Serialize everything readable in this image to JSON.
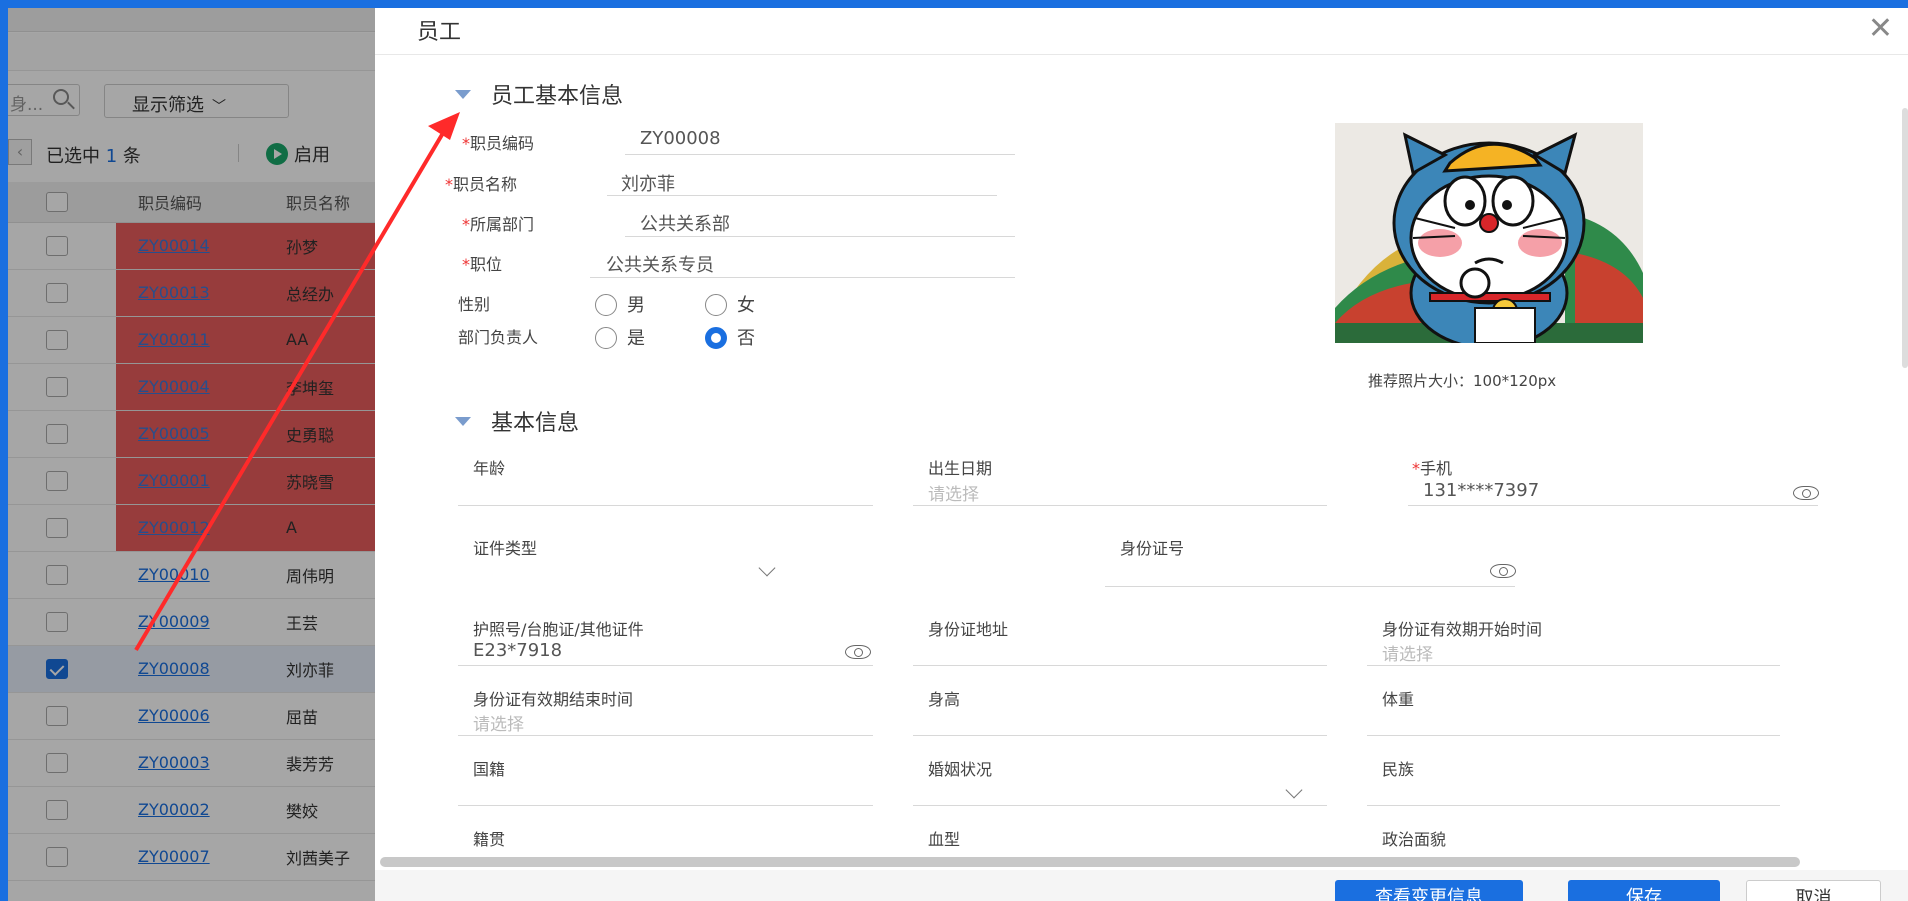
{
  "list_page": {
    "search_placeholder": "身...",
    "filter_button": "显示筛选",
    "selection": {
      "prefix": "已选中",
      "count": "1",
      "suffix": "条"
    },
    "enable_button": "启用",
    "columns": [
      "职员编码",
      "职员名称"
    ],
    "rows": [
      {
        "code": "ZY00014",
        "name": "孙梦",
        "highlight": true,
        "checked": false
      },
      {
        "code": "ZY00013",
        "name": "总经办",
        "highlight": true,
        "checked": false
      },
      {
        "code": "ZY00011",
        "name": "AA",
        "highlight": true,
        "checked": false
      },
      {
        "code": "ZY00004",
        "name": "李坤玺",
        "highlight": true,
        "checked": false
      },
      {
        "code": "ZY00005",
        "name": "史勇聪",
        "highlight": true,
        "checked": false
      },
      {
        "code": "ZY00001",
        "name": "苏晓雪",
        "highlight": true,
        "checked": false
      },
      {
        "code": "ZY00012",
        "name": "A",
        "highlight": true,
        "checked": false
      },
      {
        "code": "ZY00010",
        "name": "周伟明",
        "highlight": false,
        "checked": false
      },
      {
        "code": "ZY00009",
        "name": "王芸",
        "highlight": false,
        "checked": false
      },
      {
        "code": "ZY00008",
        "name": "刘亦菲",
        "highlight": false,
        "checked": true
      },
      {
        "code": "ZY00006",
        "name": "屈苗",
        "highlight": false,
        "checked": false
      },
      {
        "code": "ZY00003",
        "name": "裴芳芳",
        "highlight": false,
        "checked": false
      },
      {
        "code": "ZY00002",
        "name": "樊姣",
        "highlight": false,
        "checked": false
      },
      {
        "code": "ZY00007",
        "name": "刘茜美子",
        "highlight": false,
        "checked": false
      }
    ]
  },
  "dialog": {
    "title": "员工",
    "close_glyph": "✕",
    "section_basic_employee": "员工基本信息",
    "employee_code_label": "职员编码",
    "employee_code_value": "ZY00008",
    "employee_name_label": "职员名称",
    "employee_name_value": "刘亦菲",
    "department_label": "所属部门",
    "department_value": "公共关系部",
    "position_label": "职位",
    "position_value": "公共关系专员",
    "gender_label": "性别",
    "gender_options": [
      "男",
      "女"
    ],
    "dept_head_label": "部门负责人",
    "dept_head_options": [
      "是",
      "否"
    ],
    "dept_head_selected": "否",
    "required_mark": "*",
    "photo_hint": "推荐照片大小：100*120px",
    "section_basic_info": "基本信息",
    "age_label": "年龄",
    "birth_label": "出生日期",
    "birth_placeholder": "请选择",
    "mobile_label": "手机",
    "mobile_value": "131****7397",
    "id_type_label": "证件类型",
    "id_number_label": "身份证号",
    "passport_label": "护照号/台胞证/其他证件",
    "passport_value": "E23*7918",
    "id_address_label": "身份证地址",
    "id_start_label": "身份证有效期开始时间",
    "id_start_placeholder": "请选择",
    "id_end_label": "身份证有效期结束时间",
    "id_end_placeholder": "请选择",
    "height_label": "身高",
    "weight_label": "体重",
    "nationality_label": "国籍",
    "marital_label": "婚姻状况",
    "ethnicity_label": "民族",
    "native_place_label": "籍贯",
    "blood_type_label": "血型",
    "political_label": "政治面貌",
    "buttons": {
      "view_changes": "查看变更信息",
      "save": "保存",
      "cancel": "取消"
    }
  },
  "colors": {
    "accent": "#1a6fe0",
    "highlight_row": "#e85c5c",
    "arrow": "#ff2a2a"
  }
}
